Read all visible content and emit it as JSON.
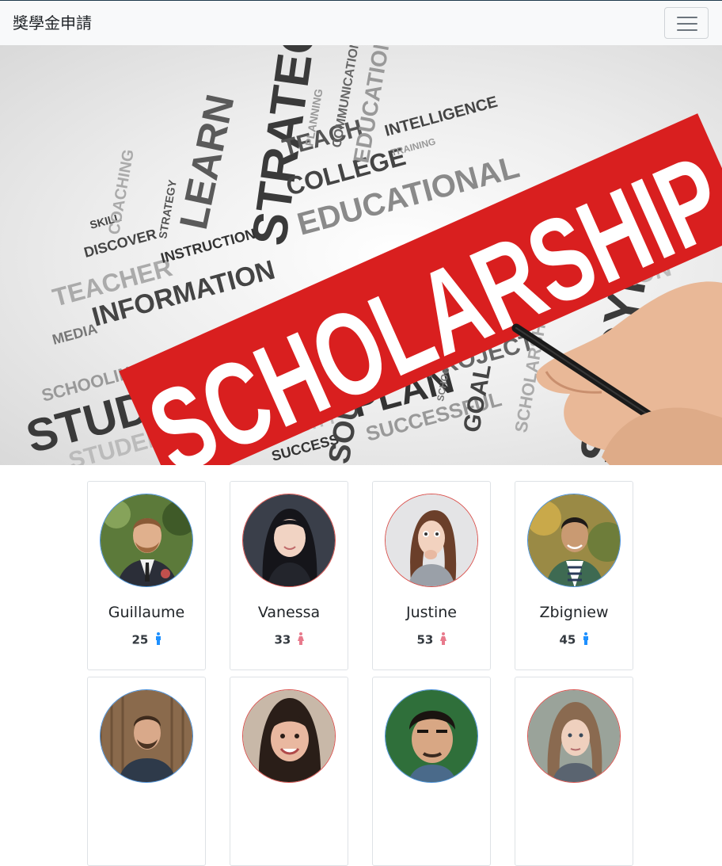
{
  "navbar": {
    "brand": "獎學金申請",
    "toggle_icon": "hamburger-menu-icon"
  },
  "hero": {
    "banner_text": "SCHOLARSHIP",
    "words": [
      "STRATEGY",
      "LEARN",
      "TEACH",
      "COLLEGE",
      "EDUCATIONAL",
      "INTELLIGENCE",
      "EDUCATION",
      "COMMUNICATION",
      "INFORMATION",
      "TEACHER",
      "DISCOVER",
      "SKILL",
      "INSTRUCTION",
      "STRATEGY",
      "COACHING",
      "MEDIA",
      "SCHOOLING",
      "STUDY",
      "STUDENT",
      "UNIVERSITY",
      "SUCCESS",
      "SOURCES",
      "PLAN",
      "SUCCESSFUL",
      "PROJECT",
      "SCHOOL",
      "GOAL",
      "SCHOLARSHIP",
      "STUDYING",
      "SOLUTION",
      "TRAINING",
      "PLANNING"
    ]
  },
  "colors": {
    "male": "#1e90ff",
    "female": "#e87a8c",
    "banner_red": "#d91f1f",
    "avatar_male_border": "#4a90d9",
    "avatar_female_border": "#d9534f"
  },
  "cards": [
    {
      "name": "Guillaume",
      "age": "25",
      "gender": "male"
    },
    {
      "name": "Vanessa",
      "age": "33",
      "gender": "female"
    },
    {
      "name": "Justine",
      "age": "53",
      "gender": "female"
    },
    {
      "name": "Zbigniew",
      "age": "45",
      "gender": "male"
    },
    {
      "name": "",
      "age": "",
      "gender": "male"
    },
    {
      "name": "",
      "age": "",
      "gender": "female"
    },
    {
      "name": "",
      "age": "",
      "gender": "male"
    },
    {
      "name": "",
      "age": "",
      "gender": "female"
    }
  ]
}
